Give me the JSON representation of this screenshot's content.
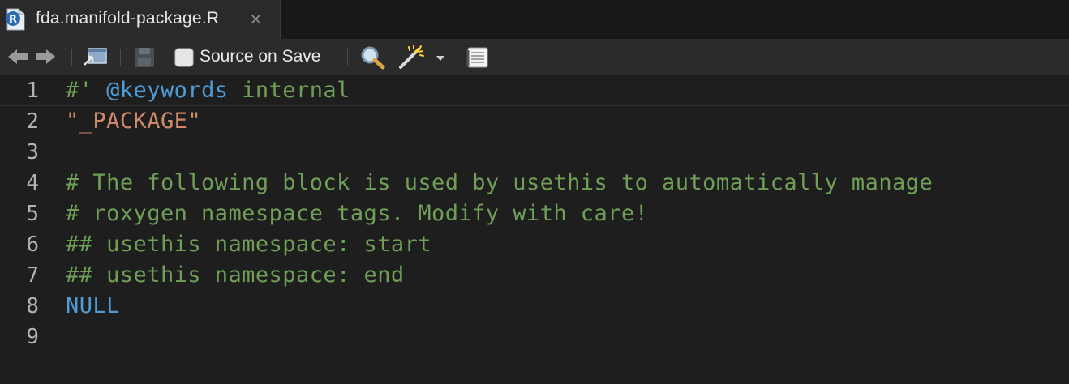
{
  "tab": {
    "title": "fda.manifold-package.R",
    "close_glyph": "×",
    "icon": "r-file-icon"
  },
  "toolbar": {
    "source_on_save_label": "Source on Save",
    "source_on_save_checked": false,
    "icons": [
      "back-arrow-icon",
      "forward-arrow-icon",
      "show-in-window-icon",
      "save-icon",
      "search-icon",
      "magic-wand-icon",
      "dropdown-caret-icon",
      "compile-report-icon"
    ]
  },
  "colors": {
    "comment": "#6f9e57",
    "keyword": "#4f9bd4",
    "string": "#cd8a6b",
    "background": "#1e1e1e"
  },
  "editor": {
    "current_line": 1,
    "lines": [
      {
        "number": "1",
        "tokens": [
          {
            "type": "comment",
            "text": "#' "
          },
          {
            "type": "keyword",
            "text": "@keywords"
          },
          {
            "type": "comment",
            "text": " internal"
          }
        ]
      },
      {
        "number": "2",
        "tokens": [
          {
            "type": "string",
            "text": "\"_PACKAGE\""
          }
        ]
      },
      {
        "number": "3",
        "tokens": []
      },
      {
        "number": "4",
        "tokens": [
          {
            "type": "comment",
            "text": "# The following block is used by usethis to automatically manage"
          }
        ]
      },
      {
        "number": "5",
        "tokens": [
          {
            "type": "comment",
            "text": "# roxygen namespace tags. Modify with care!"
          }
        ]
      },
      {
        "number": "6",
        "tokens": [
          {
            "type": "comment",
            "text": "## usethis namespace: start"
          }
        ]
      },
      {
        "number": "7",
        "tokens": [
          {
            "type": "comment",
            "text": "## usethis namespace: end"
          }
        ]
      },
      {
        "number": "8",
        "tokens": [
          {
            "type": "null",
            "text": "NULL"
          }
        ]
      },
      {
        "number": "9",
        "tokens": []
      }
    ]
  }
}
